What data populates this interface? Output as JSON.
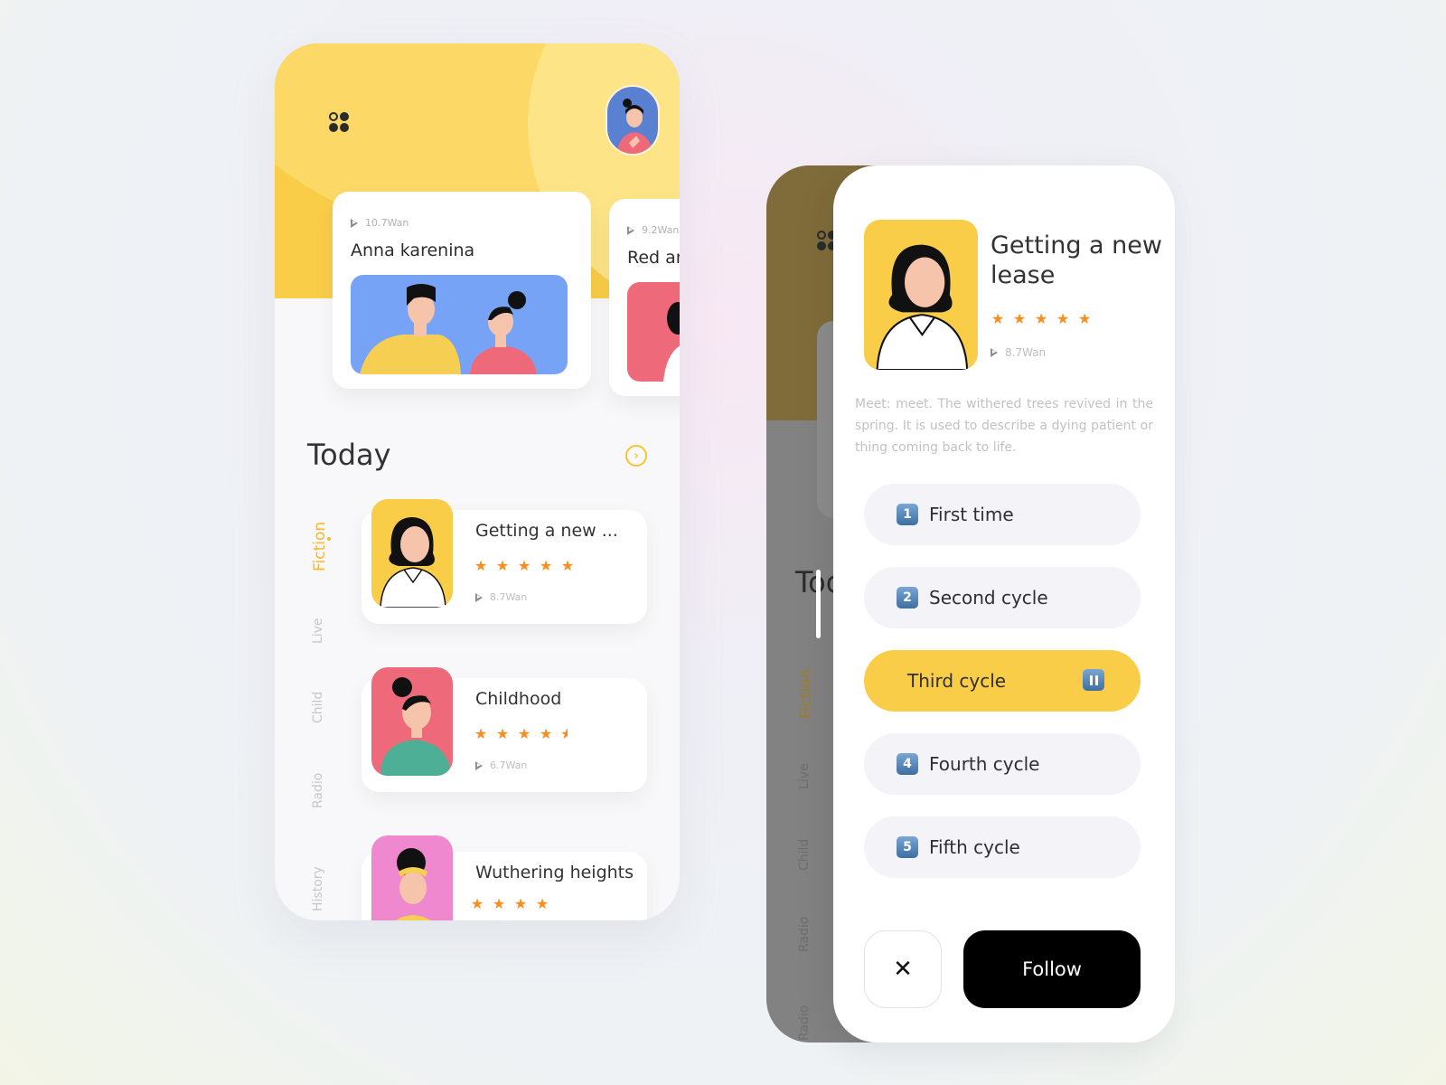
{
  "home": {
    "featured": [
      {
        "plays": "10.7Wan",
        "title": "Anna karenina"
      },
      {
        "plays": "9.2Wan",
        "title": "Red and Black"
      }
    ],
    "section_title": "Today",
    "category_tabs": [
      "Fiction",
      "Live",
      "Child",
      "Radio",
      "History"
    ],
    "active_tab": "Fiction",
    "books": [
      {
        "title": "Getting a new ...",
        "rating": 5,
        "plays": "8.7Wan",
        "cover_color": "#f9cd48"
      },
      {
        "title": "Childhood",
        "rating": 4.5,
        "plays": "6.7Wan",
        "cover_color": "#ee6a7b"
      },
      {
        "title": "Wuthering heights",
        "rating": 4,
        "plays": "",
        "cover_color": "#ef88cf"
      }
    ]
  },
  "detail": {
    "title": "Getting a new lease",
    "rating": 5,
    "plays": "8.7Wan",
    "description": "Meet: meet. The withered trees revived in the spring. It is used to describe a dying patient or thing coming back to life.",
    "episodes": [
      {
        "num": "1",
        "label": "First time",
        "active": false
      },
      {
        "num": "2",
        "label": "Second cycle",
        "active": false
      },
      {
        "num": "3",
        "label": "Third cycle",
        "active": true
      },
      {
        "num": "4",
        "label": "Fourth cycle",
        "active": false
      },
      {
        "num": "5",
        "label": "Fifth cycle",
        "active": false
      }
    ],
    "close_label": "✕",
    "follow_label": "Follow",
    "background_section_title": "Today",
    "background_tabs": [
      "Fiction",
      "Live",
      "Child",
      "Radio",
      "Radio"
    ]
  },
  "colors": {
    "accent_yellow": "#f9cd48",
    "star_orange": "#fb8c1e",
    "active_tab": "#f5b82e",
    "follow_bg": "#000000"
  }
}
